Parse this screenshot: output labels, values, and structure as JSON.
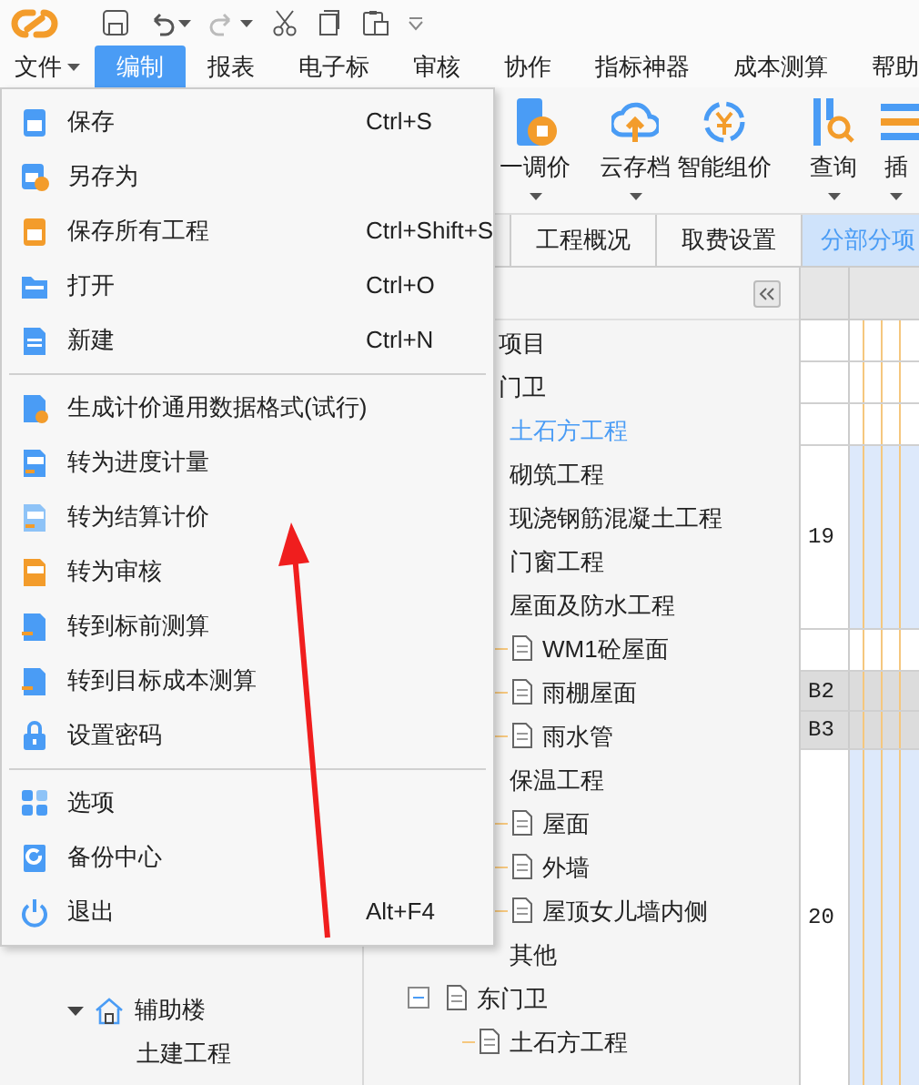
{
  "menubar": [
    {
      "label": "文件",
      "dropdown": true,
      "selected": false
    },
    {
      "label": "编制",
      "dropdown": false,
      "selected": true
    },
    {
      "label": "报表",
      "dropdown": false,
      "selected": false
    },
    {
      "label": "电子标",
      "dropdown": false,
      "selected": false
    },
    {
      "label": "审核",
      "dropdown": false,
      "selected": false
    },
    {
      "label": "协作",
      "dropdown": false,
      "selected": false
    },
    {
      "label": "指标神器",
      "dropdown": false,
      "selected": false
    },
    {
      "label": "成本测算",
      "dropdown": false,
      "selected": false
    },
    {
      "label": "帮助",
      "dropdown": false,
      "selected": false
    }
  ],
  "toolbar": [
    {
      "label": "一调价",
      "dropdown": true
    },
    {
      "label": "云存档",
      "dropdown": true
    },
    {
      "label": "智能组价",
      "dropdown": false
    },
    {
      "label": "查询",
      "dropdown": true
    },
    {
      "label": "插",
      "dropdown": true
    }
  ],
  "tabs": [
    {
      "label": "工程概况",
      "selected": false
    },
    {
      "label": "取费设置",
      "selected": false
    },
    {
      "label": "分部分项",
      "selected": true
    }
  ],
  "file_menu": {
    "groups": [
      [
        {
          "label": "保存",
          "shortcut": "Ctrl+S"
        },
        {
          "label": "另存为"
        },
        {
          "label": "保存所有工程",
          "shortcut": "Ctrl+Shift+S"
        },
        {
          "label": "打开",
          "shortcut": "Ctrl+O"
        },
        {
          "label": "新建",
          "shortcut": "Ctrl+N"
        }
      ],
      [
        {
          "label": "生成计价通用数据格式(试行)"
        },
        {
          "label": "转为进度计量"
        },
        {
          "label": "转为结算计价"
        },
        {
          "label": "转为审核"
        },
        {
          "label": "转到标前测算"
        },
        {
          "label": "转到目标成本测算"
        },
        {
          "label": "设置密码"
        }
      ],
      [
        {
          "label": "选项"
        },
        {
          "label": "备份中心"
        },
        {
          "label": "退出",
          "shortcut": "Alt+F4"
        }
      ]
    ]
  },
  "project_tree": [
    {
      "label": "辅助楼",
      "expanded": true,
      "children": [
        {
          "label": "土建工程"
        }
      ]
    }
  ],
  "tree": [
    {
      "label": "项目",
      "selected": false,
      "children": [
        {
          "label": "门卫",
          "selected": false,
          "children": [
            {
              "label": "土石方工程",
              "selected": true
            },
            {
              "label": "砌筑工程",
              "selected": false
            },
            {
              "label": "现浇钢筋混凝土工程",
              "selected": false
            },
            {
              "label": "门窗工程",
              "selected": false
            },
            {
              "label": "屋面及防水工程",
              "selected": false,
              "children": [
                {
                  "label": "WM1砼屋面",
                  "selected": false
                },
                {
                  "label": "雨棚屋面",
                  "selected": false
                },
                {
                  "label": "雨水管",
                  "selected": false
                }
              ]
            },
            {
              "label": "保温工程",
              "selected": false,
              "children": [
                {
                  "label": "屋面",
                  "selected": false
                },
                {
                  "label": "外墙",
                  "selected": false
                },
                {
                  "label": "屋顶女儿墙内侧",
                  "selected": false
                }
              ]
            },
            {
              "label": "其他",
              "selected": false
            }
          ]
        },
        {
          "label": "东门卫",
          "selected": false,
          "children": [
            {
              "label": "土石方工程",
              "selected": false
            }
          ]
        }
      ]
    }
  ],
  "grid_rows": [
    {
      "kind": "blank"
    },
    {
      "kind": "blank"
    },
    {
      "kind": "blank"
    },
    {
      "kind": "item",
      "number": "19"
    },
    {
      "kind": "blank"
    },
    {
      "kind": "group",
      "number": "B2"
    },
    {
      "kind": "group",
      "number": "B3"
    },
    {
      "kind": "item",
      "number": "20"
    }
  ]
}
